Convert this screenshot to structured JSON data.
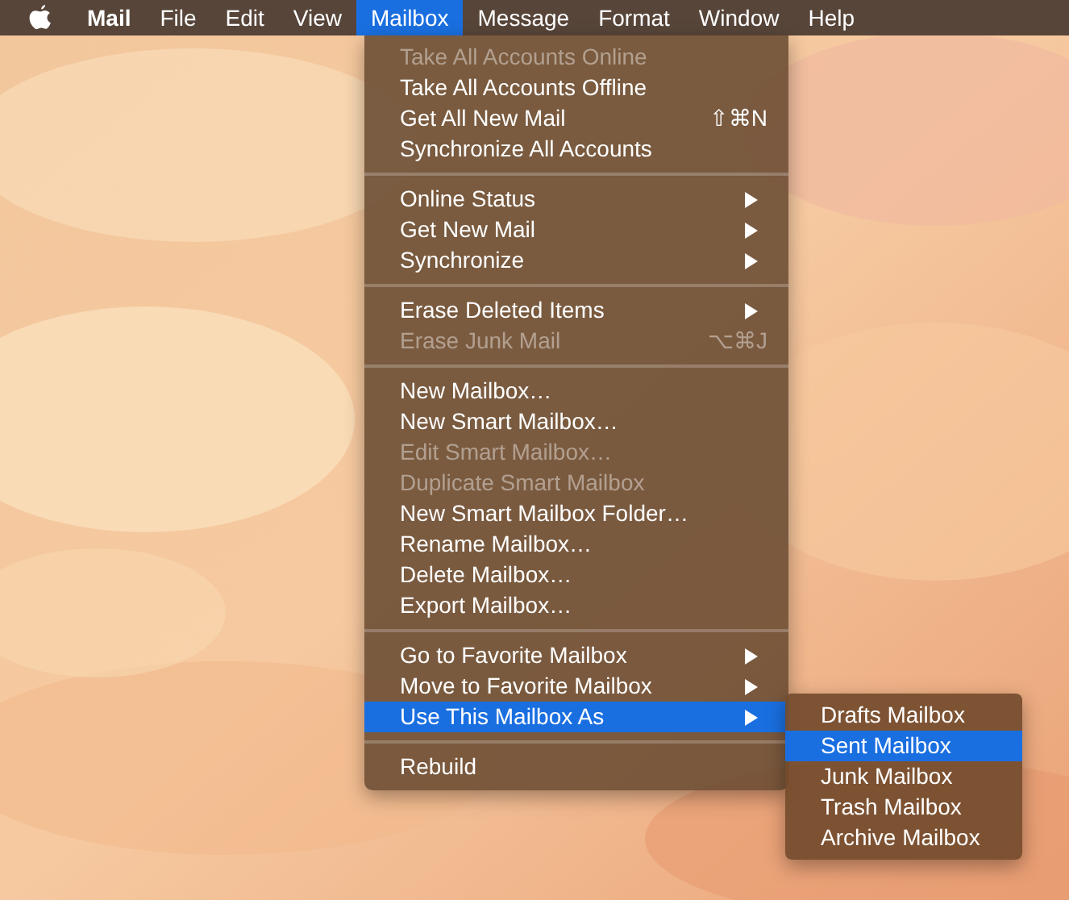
{
  "menu_bar": {
    "app_name": "Mail",
    "menus": [
      {
        "label": "File",
        "selected": false
      },
      {
        "label": "Edit",
        "selected": false
      },
      {
        "label": "View",
        "selected": false
      },
      {
        "label": "Mailbox",
        "selected": true
      },
      {
        "label": "Message",
        "selected": false
      },
      {
        "label": "Format",
        "selected": false
      },
      {
        "label": "Window",
        "selected": false
      },
      {
        "label": "Help",
        "selected": false
      }
    ]
  },
  "mailbox_menu": {
    "groups": [
      [
        {
          "label": "Take All Accounts Online",
          "disabled": true,
          "selected": false
        },
        {
          "label": "Take All Accounts Offline",
          "disabled": false,
          "selected": false
        },
        {
          "label": "Get All New Mail",
          "shortcut": "⇧⌘N",
          "disabled": false,
          "selected": false
        },
        {
          "label": "Synchronize All Accounts",
          "disabled": false,
          "selected": false
        }
      ],
      [
        {
          "label": "Online Status",
          "submenu": true,
          "disabled": false,
          "selected": false
        },
        {
          "label": "Get New Mail",
          "submenu": true,
          "disabled": false,
          "selected": false
        },
        {
          "label": "Synchronize",
          "submenu": true,
          "disabled": false,
          "selected": false
        }
      ],
      [
        {
          "label": "Erase Deleted Items",
          "submenu": true,
          "disabled": false,
          "selected": false
        },
        {
          "label": "Erase Junk Mail",
          "shortcut": "⌥⌘J",
          "disabled": true,
          "selected": false
        }
      ],
      [
        {
          "label": "New Mailbox…",
          "disabled": false,
          "selected": false
        },
        {
          "label": "New Smart Mailbox…",
          "disabled": false,
          "selected": false
        },
        {
          "label": "Edit Smart Mailbox…",
          "disabled": true,
          "selected": false
        },
        {
          "label": "Duplicate Smart Mailbox",
          "disabled": true,
          "selected": false
        },
        {
          "label": "New Smart Mailbox Folder…",
          "disabled": false,
          "selected": false
        },
        {
          "label": "Rename Mailbox…",
          "disabled": false,
          "selected": false
        },
        {
          "label": "Delete Mailbox…",
          "disabled": false,
          "selected": false
        },
        {
          "label": "Export Mailbox…",
          "disabled": false,
          "selected": false
        }
      ],
      [
        {
          "label": "Go to Favorite Mailbox",
          "submenu": true,
          "disabled": false,
          "selected": false
        },
        {
          "label": "Move to Favorite Mailbox",
          "submenu": true,
          "disabled": false,
          "selected": false
        },
        {
          "label": "Use This Mailbox As",
          "submenu": true,
          "disabled": false,
          "selected": true
        }
      ],
      [
        {
          "label": "Rebuild",
          "disabled": false,
          "selected": false
        }
      ]
    ]
  },
  "submenu": {
    "items": [
      {
        "label": "Drafts Mailbox",
        "selected": false
      },
      {
        "label": "Sent Mailbox",
        "selected": true
      },
      {
        "label": "Junk Mailbox",
        "selected": false
      },
      {
        "label": "Trash Mailbox",
        "selected": false
      },
      {
        "label": "Archive Mailbox",
        "selected": false
      }
    ]
  }
}
